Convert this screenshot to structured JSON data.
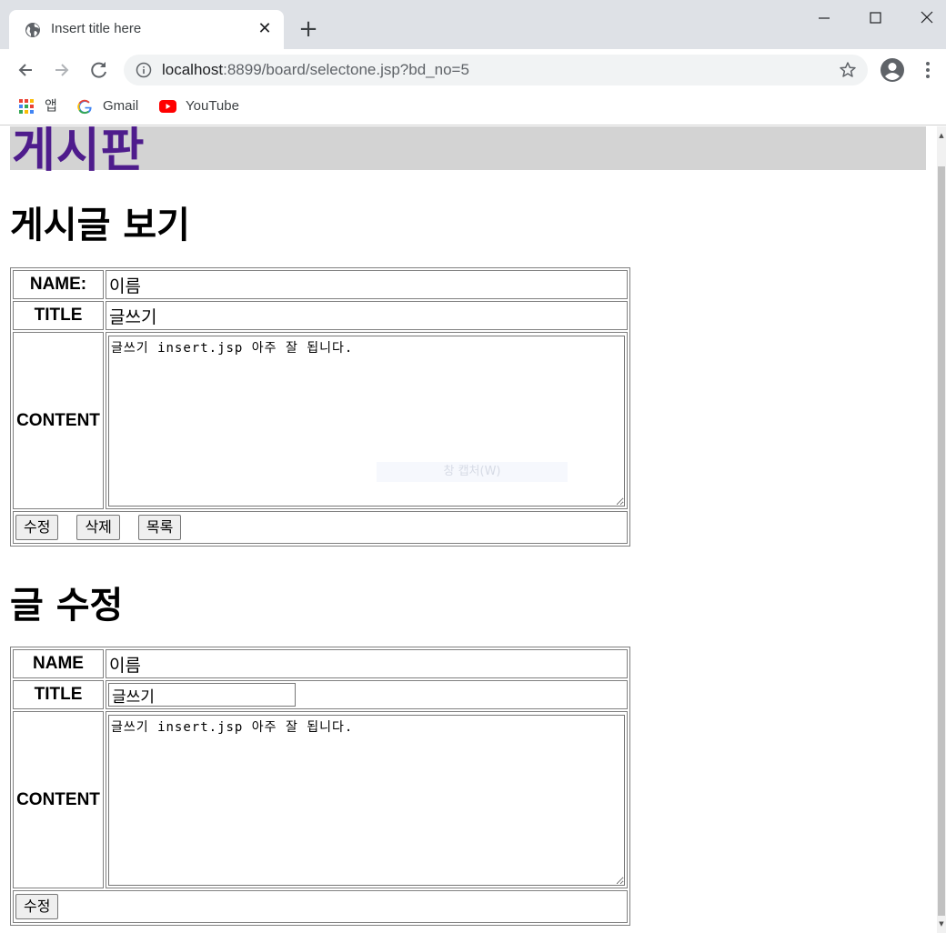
{
  "browser": {
    "tab_title": "Insert title here",
    "url_host": "localhost",
    "url_rest": ":8899/board/selectone.jsp?bd_no=5",
    "bookmarks": [
      {
        "label": "앱",
        "icon": "apps-grid-icon"
      },
      {
        "label": "Gmail",
        "icon": "google-icon"
      },
      {
        "label": "YouTube",
        "icon": "youtube-icon"
      }
    ]
  },
  "header": {
    "title": "게시판"
  },
  "view_section": {
    "heading": "게시글 보기",
    "name_label": "NAME:",
    "name_value": "이름",
    "title_label": "TITLE",
    "title_value": "글쓰기",
    "content_label": "CONTENT",
    "content_value": "글쓰기 insert.jsp 아주 잘 됩니다.",
    "overlay_text": "창 캡처(W)",
    "buttons": {
      "edit": "수정",
      "delete": "삭제",
      "list": "목록"
    }
  },
  "edit_section": {
    "heading": "글 수정",
    "name_label": "NAME",
    "name_value": "이름",
    "title_label": "TITLE",
    "title_value": "글쓰기",
    "content_label": "CONTENT",
    "content_value": "글쓰기 insert.jsp 아주 잘 됩니다.",
    "buttons": {
      "edit": "수정"
    }
  },
  "colors": {
    "header_bg": "#d3d3d3",
    "header_text": "#4e1c8c",
    "tabstrip": "#dee1e6"
  }
}
